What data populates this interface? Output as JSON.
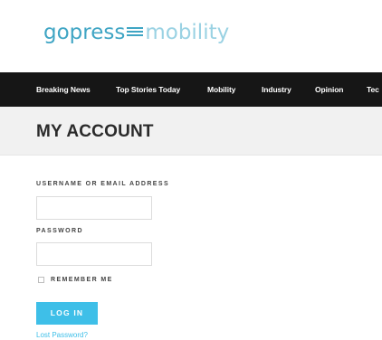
{
  "logo": {
    "part1": "gopress",
    "part2": "mobility"
  },
  "nav": {
    "items": [
      "Breaking News",
      "Top Stories Today",
      "Mobility",
      "Industry",
      "Opinion",
      "Tec"
    ]
  },
  "page": {
    "title": "MY ACCOUNT"
  },
  "form": {
    "username_label": "USERNAME OR EMAIL ADDRESS",
    "username_value": "",
    "password_label": "PASSWORD",
    "password_value": "",
    "remember_label": "REMEMBER ME",
    "remember_checked": false,
    "login_label": "LOG IN",
    "lost_password_label": "Lost Password?"
  },
  "colors": {
    "accent": "#3ebfe8",
    "logo_dark": "#3fa5c4",
    "logo_light": "#9ad2e3",
    "nav_bg": "#161616"
  }
}
